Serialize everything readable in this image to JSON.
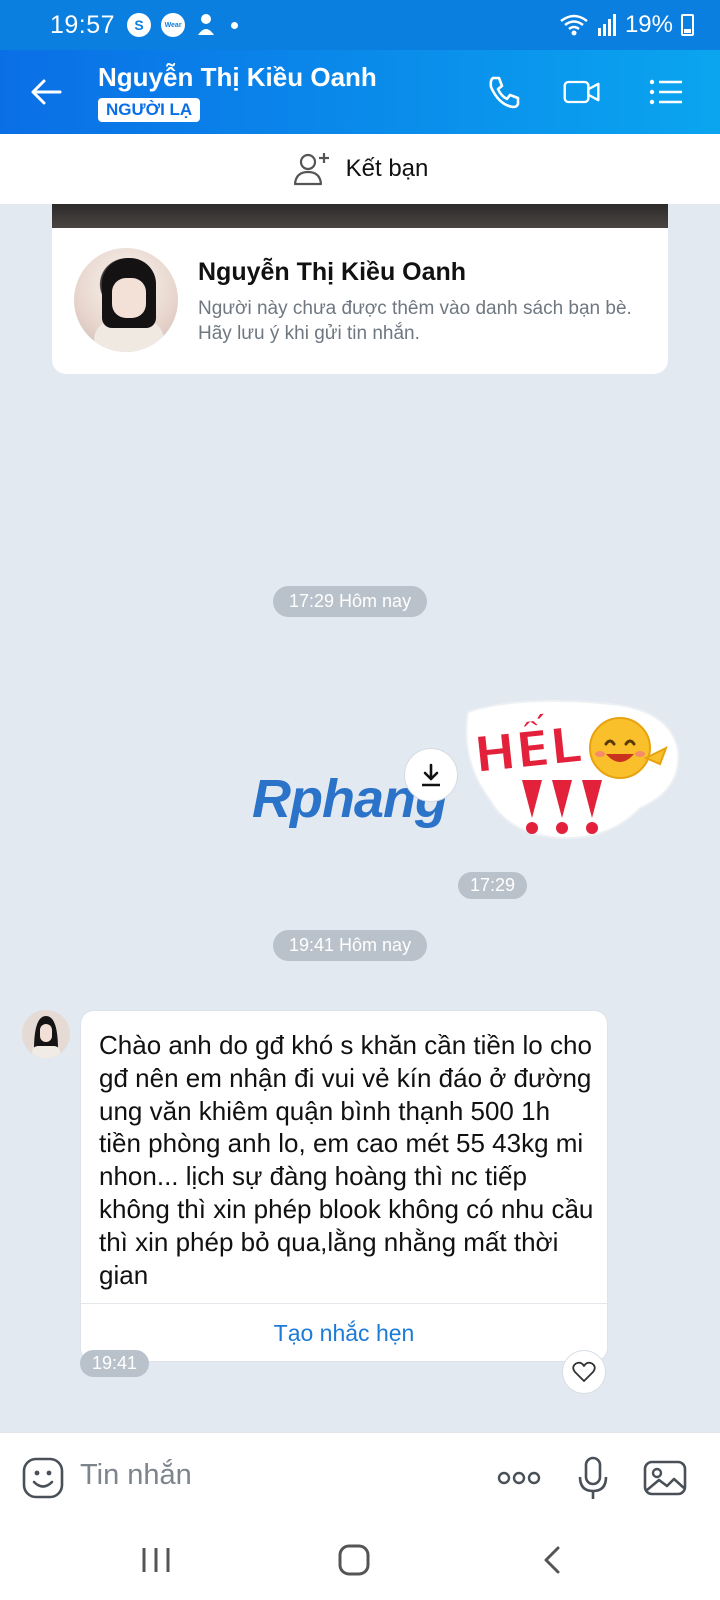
{
  "status_bar": {
    "time": "19:57",
    "battery": "19%",
    "icons": [
      "s-icon",
      "wear-icon",
      "notification-icon",
      "dot-icon",
      "wifi-icon",
      "signal-icon",
      "battery-icon"
    ]
  },
  "header": {
    "contact_name": "Nguyễn Thị Kiều Oanh",
    "badge": "NGƯỜI LẠ",
    "actions": [
      "phone-icon",
      "video-icon",
      "menu-icon"
    ]
  },
  "friend_bar": {
    "label": "Kết bạn"
  },
  "profile_card": {
    "name": "Nguyễn Thị Kiều Oanh",
    "note": "Người này chưa được thêm vào danh sách bạn bè. Hãy lưu ý khi gửi tin nhắn."
  },
  "timeline": {
    "first_divider": "17:29 Hôm nay",
    "sticker_time": "17:29",
    "second_divider": "19:41 Hôm nay"
  },
  "sticker": {
    "text": "HẾLLO",
    "watermark": "Rphang"
  },
  "message": {
    "text": "Chào anh do gđ khó s khăn cần tiền lo cho gđ nên em nhận đi vui vẻ kín đáo ở đường ung văn khiêm quận bình thạnh 500 1h tiền phòng anh lo, em cao mét 55 43kg mi nhon... lịch sự đàng hoàng thì nc tiếp không thì xin phép blook không có nhu cầu thì xin phép bỏ qua,lằng nhằng mất thời gian",
    "action": "Tạo nhắc hẹn",
    "time": "19:41"
  },
  "input_bar": {
    "placeholder": "Tin nhắn"
  },
  "colors": {
    "header_start": "#0a6fe6",
    "header_end": "#0aa5ef",
    "background": "#e2e9f1",
    "accent": "#1b7bd6"
  }
}
